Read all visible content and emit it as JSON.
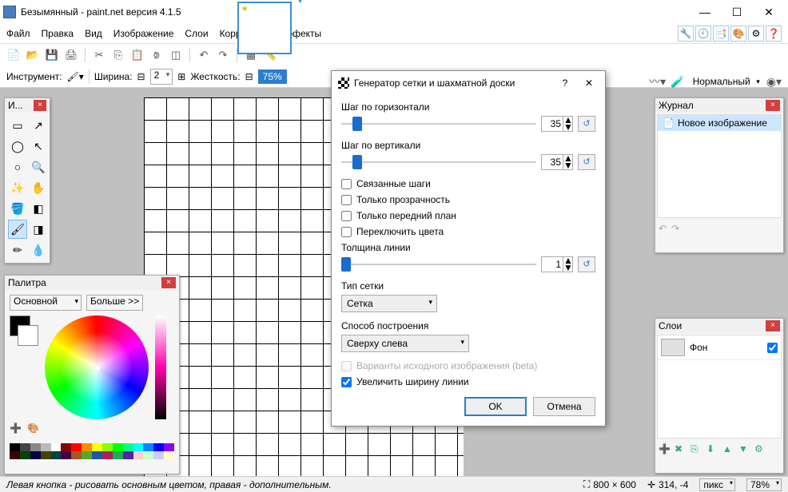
{
  "window": {
    "title": "Безымянный - paint.net версия 4.1.5"
  },
  "menu": {
    "items": [
      "Файл",
      "Правка",
      "Вид",
      "Изображение",
      "Слои",
      "Коррекция",
      "Эффекты"
    ]
  },
  "tool_options": {
    "instrument_label": "Инструмент:",
    "width_label": "Ширина:",
    "width_value": "2",
    "hardness_label": "Жесткость:",
    "hardness_value": "75%",
    "antialias_label": "Нормальный"
  },
  "tools_panel": {
    "title": "И..."
  },
  "palette_panel": {
    "title": "Палитра",
    "mode": "Основной",
    "more": "Больше >>",
    "strip_colors": [
      "#000",
      "#444",
      "#888",
      "#bbb",
      "#fff",
      "#800",
      "#f00",
      "#f80",
      "#ff0",
      "#8f0",
      "#0f0",
      "#0f8",
      "#0ff",
      "#08f",
      "#00f",
      "#80f",
      "#400",
      "#040",
      "#004",
      "#440",
      "#044",
      "#404",
      "#a52",
      "#5a2",
      "#25a",
      "#a25",
      "#2a5",
      "#52a",
      "#fcc",
      "#cfc",
      "#ccf",
      "#ffc"
    ]
  },
  "history_panel": {
    "title": "Журнал",
    "item": "Новое изображение"
  },
  "layers_panel": {
    "title": "Слои",
    "layer": "Фон"
  },
  "dialog": {
    "title": "Генератор сетки и шахматной доски",
    "h_step_label": "Шаг по горизонтали",
    "h_step_value": "35",
    "v_step_label": "Шаг по вертикали",
    "v_step_value": "35",
    "linked_label": "Связанные шаги",
    "transparency_label": "Только прозрачность",
    "foreground_label": "Только передний план",
    "swap_colors_label": "Переключить цвета",
    "line_width_label": "Толщина линии",
    "line_width_value": "1",
    "grid_type_label": "Тип сетки",
    "grid_type_value": "Сетка",
    "build_mode_label": "Способ построения",
    "build_mode_value": "Сверху слева",
    "variants_label": "Варианты исходного изображения (beta)",
    "enlarge_label": "Увеличить ширину линии",
    "ok": "OK",
    "cancel": "Отмена"
  },
  "statusbar": {
    "hint": "Левая кнопка - рисовать основным цветом, правая - дополнительным.",
    "size": "800 × 600",
    "pos": "314, -4",
    "unit": "пикс",
    "zoom": "78%"
  }
}
